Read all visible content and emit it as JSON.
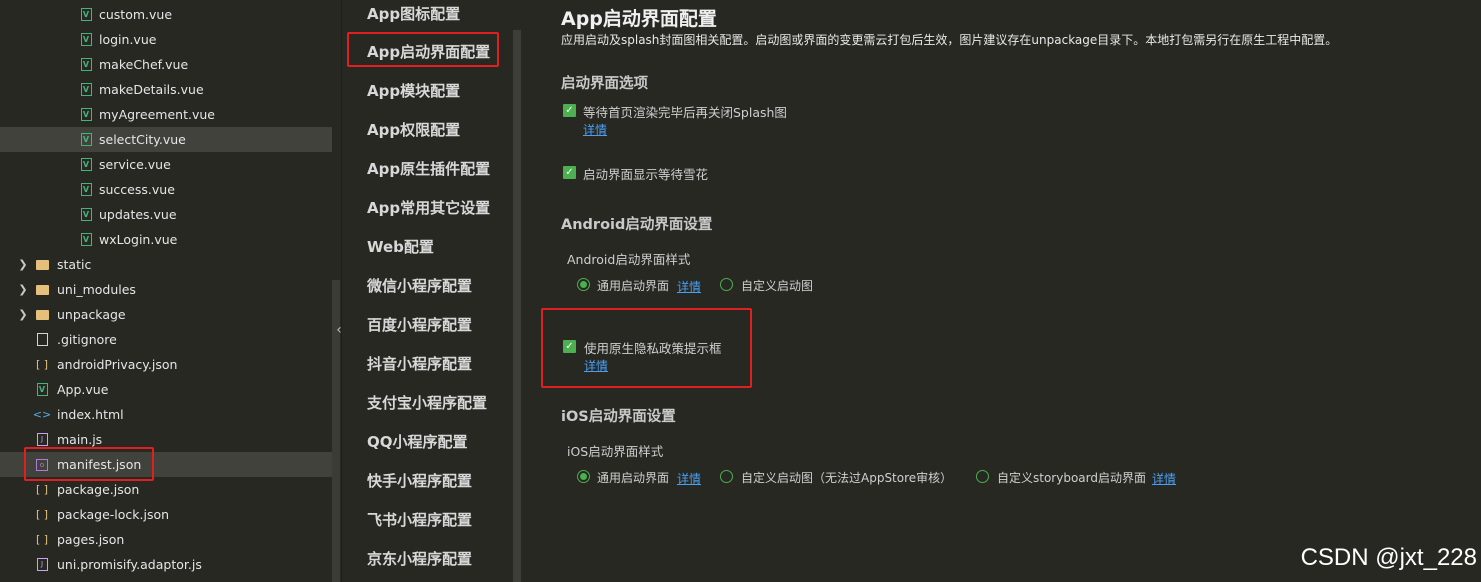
{
  "file_tree": {
    "items": [
      {
        "label": "custom.vue",
        "icon": "vue-file-icon"
      },
      {
        "label": "login.vue",
        "icon": "vue-file-icon"
      },
      {
        "label": "makeChef.vue",
        "icon": "vue-file-icon"
      },
      {
        "label": "makeDetails.vue",
        "icon": "vue-file-icon"
      },
      {
        "label": "myAgreement.vue",
        "icon": "vue-file-icon"
      },
      {
        "label": "selectCity.vue",
        "icon": "vue-file-icon"
      },
      {
        "label": "service.vue",
        "icon": "vue-file-icon"
      },
      {
        "label": "success.vue",
        "icon": "vue-file-icon"
      },
      {
        "label": "updates.vue",
        "icon": "vue-file-icon"
      },
      {
        "label": "wxLogin.vue",
        "icon": "vue-file-icon"
      },
      {
        "label": "static",
        "icon": "folder-icon"
      },
      {
        "label": "uni_modules",
        "icon": "folder-icon"
      },
      {
        "label": "unpackage",
        "icon": "folder-icon"
      },
      {
        "label": ".gitignore",
        "icon": "file-icon"
      },
      {
        "label": "androidPrivacy.json",
        "icon": "json-file-icon"
      },
      {
        "label": "App.vue",
        "icon": "vue-file-icon"
      },
      {
        "label": "index.html",
        "icon": "html-file-icon"
      },
      {
        "label": "main.js",
        "icon": "js-file-icon"
      },
      {
        "label": "manifest.json",
        "icon": "manifest-file-icon"
      },
      {
        "label": "package.json",
        "icon": "json-file-icon"
      },
      {
        "label": "package-lock.json",
        "icon": "json-file-icon"
      },
      {
        "label": "pages.json",
        "icon": "json-file-icon"
      },
      {
        "label": "uni.promisify.adaptor.js",
        "icon": "js-file-icon"
      }
    ],
    "selected": "selectCity.vue",
    "highlighted": "manifest.json"
  },
  "nav": {
    "items": [
      "App图标配置",
      "App启动界面配置",
      "App模块配置",
      "App权限配置",
      "App原生插件配置",
      "App常用其它设置",
      "Web配置",
      "微信小程序配置",
      "百度小程序配置",
      "抖音小程序配置",
      "支付宝小程序配置",
      "QQ小程序配置",
      "快手小程序配置",
      "飞书小程序配置",
      "京东小程序配置"
    ],
    "active": "App启动界面配置"
  },
  "content": {
    "title": "App启动界面配置",
    "description": "应用启动及splash封面图相关配置。启动图或界面的变更需云打包后生效，图片建议存在unpackage目录下。本地打包需另行在原生工程中配置。",
    "splash_options": {
      "heading": "启动界面选项",
      "wait_render": {
        "label": "等待首页渲染完毕后再关闭Splash图",
        "checked": true,
        "link": "详情"
      },
      "show_waiting": {
        "label": "启动界面显示等待雪花",
        "checked": true
      }
    },
    "android": {
      "heading": "Android启动界面设置",
      "style_label": "Android启动界面样式",
      "options": [
        {
          "label": "通用启动界面",
          "selected": true,
          "link": "详情"
        },
        {
          "label": "自定义启动图",
          "selected": false
        }
      ],
      "privacy": {
        "label": "使用原生隐私政策提示框",
        "checked": true,
        "link": "详情"
      }
    },
    "ios": {
      "heading": "iOS启动界面设置",
      "style_label": "iOS启动界面样式",
      "options": [
        {
          "label": "通用启动界面",
          "selected": true,
          "link": "详情"
        },
        {
          "label": "自定义启动图（无法过AppStore审核）",
          "selected": false
        },
        {
          "label": "自定义storyboard启动界面",
          "selected": false,
          "link": "详情"
        }
      ]
    }
  },
  "watermark": "CSDN @jxt_228",
  "colors": {
    "accent": "#4caf50",
    "link": "#4a9ff5",
    "highlight_box": "#e02020",
    "background": "#272822"
  }
}
